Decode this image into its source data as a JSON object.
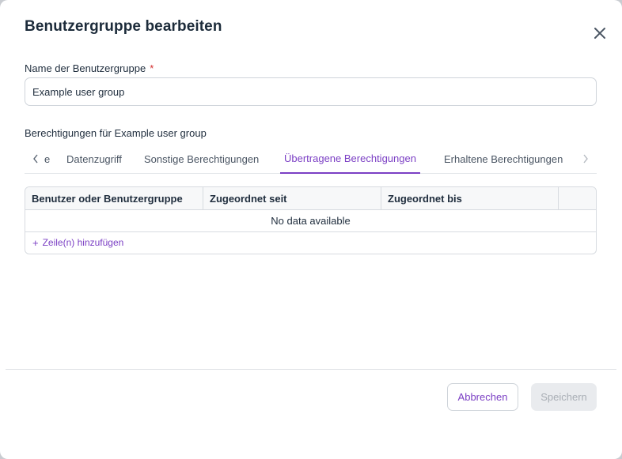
{
  "dialog": {
    "title": "Benutzergruppe bearbeiten",
    "close_icon": "close-icon"
  },
  "name_field": {
    "label": "Name der Benutzergruppe",
    "required_marker": "*",
    "value": "Example user group"
  },
  "permissions": {
    "heading": "Berechtigungen für Example user group",
    "tabs": [
      {
        "label": "e",
        "active": false
      },
      {
        "label": "Datenzugriff",
        "active": false
      },
      {
        "label": "Sonstige Berechtigungen",
        "active": false
      },
      {
        "label": "Übertragene Berechtigungen",
        "active": true
      },
      {
        "label": "Erhaltene Berechtigungen",
        "active": false
      }
    ],
    "scroll_left_icon": "chevron-left-icon",
    "scroll_right_icon": "chevron-right-icon"
  },
  "table": {
    "columns": [
      "Benutzer oder Benutzergruppe",
      "Zugeordnet seit",
      "Zugeordnet bis",
      ""
    ],
    "empty_text": "No data available",
    "add_row_label": "Zeile(n) hinzufügen",
    "add_row_icon": "plus-icon"
  },
  "footer": {
    "cancel_label": "Abbrechen",
    "save_label": "Speichern"
  },
  "colors": {
    "accent": "#7b3fc4",
    "required": "#d32f2f",
    "disabled_bg": "#e9ebee",
    "disabled_text": "#a9aeb5"
  }
}
